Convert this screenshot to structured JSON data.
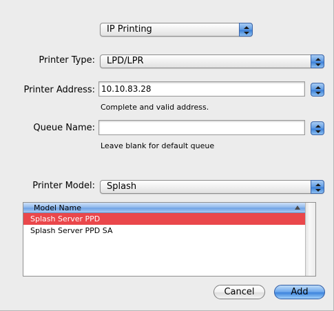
{
  "connection_popup": {
    "value": "IP Printing"
  },
  "printer_type": {
    "label": "Printer Type:",
    "value": "LPD/LPR"
  },
  "printer_address": {
    "label": "Printer Address:",
    "value": "10.10.83.28",
    "hint": "Complete and valid address."
  },
  "queue_name": {
    "label": "Queue Name:",
    "value": "",
    "hint": "Leave blank for default queue"
  },
  "printer_model": {
    "label": "Printer Model:",
    "value": "Splash"
  },
  "model_list": {
    "column_header": "Model Name",
    "rows": [
      {
        "label": "Splash Server PPD",
        "selected": true
      },
      {
        "label": "Splash Server PPD SA",
        "selected": false
      }
    ]
  },
  "buttons": {
    "cancel_label": "Cancel",
    "add_label": "Add"
  },
  "colors": {
    "selection": "#ea474b",
    "aqua_blue": "#5e9ae3"
  },
  "icons": [
    "popup-arrows-icon",
    "history-arrows-icon",
    "sort-ascending-icon"
  ]
}
